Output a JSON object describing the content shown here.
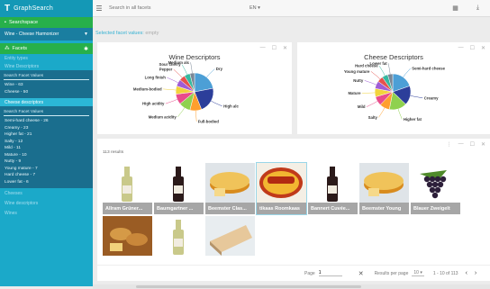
{
  "app": {
    "name": "GraphSearch",
    "logo_glyph": "Τ"
  },
  "sidebar": {
    "workspace_header": "Searchspace",
    "workspace_value": "Wine - Cheese Harmonizer",
    "facets_header": "Facets",
    "facets": [
      {
        "title": "Entity types",
        "active": false
      },
      {
        "title": "Wine Descriptors",
        "active": false,
        "search_placeholder": "Search Facet Values",
        "values": [
          "Wine - 63",
          "Cheese - 50"
        ]
      },
      {
        "title": "Cheese descriptors",
        "active": true,
        "search_placeholder": "Search Facet Values",
        "values": [
          "Semi-hard cheese - 26",
          "Creamy - 23",
          "Higher fat - 21",
          "Salty - 12",
          "Mild - 11",
          "Mature - 10",
          "Nutty - 9",
          "Young mature - 7",
          "Hard cheese - 7",
          "Lower fat - 6"
        ]
      }
    ],
    "more_facets": [
      "Cheeses",
      "Wine descriptors",
      "Wines"
    ]
  },
  "topbar": {
    "search_placeholder": "Search in all facets",
    "language": "EN ▾"
  },
  "selected_facets": {
    "label": "Selected facet values:",
    "value": "empty"
  },
  "charts": [
    {
      "title": "Wine Descriptors",
      "chart_data": {
        "type": "pie",
        "title": "Wine Descriptors",
        "labels": [
          "Dry",
          "High alc",
          "Full-bodied",
          "Medium acidity",
          "High acidity",
          "Medium-bodied",
          "Long finish",
          "Pepper",
          "Sour cherry",
          "Medium alc"
        ],
        "values": [
          22,
          22,
          10,
          10,
          9,
          7,
          6,
          5,
          5,
          4
        ],
        "colors": [
          "#4c9fd6",
          "#2c3e9a",
          "#ff9f2d",
          "#8fd14f",
          "#e94c8b",
          "#f2d33c",
          "#a05cd6",
          "#e6524d",
          "#36b9a0",
          "#7a8796"
        ]
      }
    },
    {
      "title": "Cheese Descriptors",
      "chart_data": {
        "type": "pie",
        "title": "Cheese Descriptors",
        "labels": [
          "Semi-hard cheese",
          "Creamy",
          "Higher fat",
          "Salty",
          "Mild",
          "Mature",
          "Nutty",
          "Young mature",
          "Hard cheese",
          "Lower fat"
        ],
        "values": [
          26,
          23,
          21,
          12,
          11,
          10,
          9,
          7,
          7,
          6
        ],
        "colors": [
          "#4c9fd6",
          "#2c3e9a",
          "#8fd14f",
          "#ff9f2d",
          "#e94c8b",
          "#f2d33c",
          "#a05cd6",
          "#e6524d",
          "#36b9a0",
          "#7a8796"
        ]
      }
    }
  ],
  "results": {
    "count_text": "113 results",
    "items": [
      {
        "label": "Allram Grüner...",
        "image": "white-wine-bottle"
      },
      {
        "label": "Baumgartner ...",
        "image": "red-wine-bottle"
      },
      {
        "label": "Beemster Clas...",
        "image": "cheese-wheel"
      },
      {
        "label": "tikaas Roomkaas",
        "image": "cheese-box",
        "selected": true
      },
      {
        "label": "Bannert Cuvée...",
        "image": "red-wine-bottle"
      },
      {
        "label": "Beemster Young",
        "image": "cheese-wheel"
      },
      {
        "label": "Blauer Zweigelt",
        "image": "grapes"
      },
      {
        "label": "",
        "image": "bread-cheese"
      },
      {
        "label": "",
        "image": "white-wine-bottle"
      },
      {
        "label": "",
        "image": "cheese-slice"
      }
    ],
    "pager": {
      "page_label": "Page",
      "page_value": "1",
      "rpp_label": "Results per page",
      "rpp_value": "10 ▾",
      "range": "1 - 10 of 113",
      "prev": "‹",
      "next": "›"
    }
  },
  "icons": {
    "menu": "menu-icon",
    "grid": "grid-view-icon",
    "download": "download-icon"
  }
}
